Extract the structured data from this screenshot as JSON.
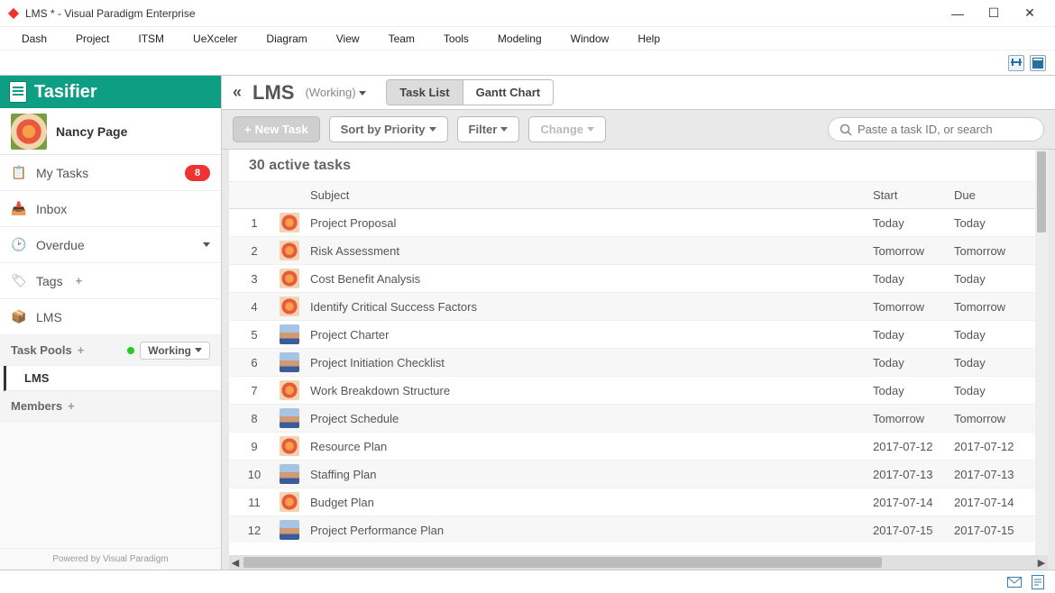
{
  "window": {
    "title": "LMS * - Visual Paradigm Enterprise"
  },
  "menu": [
    "Dash",
    "Project",
    "ITSM",
    "UeXceler",
    "Diagram",
    "View",
    "Team",
    "Tools",
    "Modeling",
    "Window",
    "Help"
  ],
  "sidebar": {
    "app_title": "Tasifier",
    "user_name": "Nancy Page",
    "items": {
      "mytasks": "My Tasks",
      "mytasks_badge": "8",
      "inbox": "Inbox",
      "overdue": "Overdue",
      "tags": "Tags",
      "lms": "LMS"
    },
    "pools_label": "Task Pools",
    "pools_filter": "Working",
    "pool_item": "LMS",
    "members_label": "Members",
    "footer": "Powered by Visual Paradigm"
  },
  "content": {
    "project": "LMS",
    "project_state": "(Working)",
    "tabs": {
      "tasklist": "Task List",
      "gantt": "Gantt Chart"
    },
    "toolbar": {
      "new_task": "New Task",
      "sort": "Sort by Priority",
      "filter": "Filter",
      "change": "Change"
    },
    "search_placeholder": "Paste a task ID, or search",
    "active_header": "30 active tasks",
    "columns": {
      "subject": "Subject",
      "start": "Start",
      "due": "Due"
    },
    "rows": [
      {
        "n": "1",
        "av": "flower",
        "subject": "Project Proposal",
        "start": "Today",
        "due": "Today"
      },
      {
        "n": "2",
        "av": "flower",
        "subject": "Risk Assessment",
        "start": "Tomorrow",
        "due": "Tomorrow"
      },
      {
        "n": "3",
        "av": "flower",
        "subject": "Cost Benefit Analysis",
        "start": "Today",
        "due": "Today"
      },
      {
        "n": "4",
        "av": "flower",
        "subject": "Identify Critical Success Factors",
        "start": "Tomorrow",
        "due": "Tomorrow"
      },
      {
        "n": "5",
        "av": "person",
        "subject": "Project Charter",
        "start": "Today",
        "due": "Today"
      },
      {
        "n": "6",
        "av": "person",
        "subject": "Project Initiation Checklist",
        "start": "Today",
        "due": "Today"
      },
      {
        "n": "7",
        "av": "flower",
        "subject": "Work Breakdown Structure",
        "start": "Today",
        "due": "Today"
      },
      {
        "n": "8",
        "av": "person",
        "subject": "Project Schedule",
        "start": "Tomorrow",
        "due": "Tomorrow"
      },
      {
        "n": "9",
        "av": "flower",
        "subject": "Resource Plan",
        "start": "2017-07-12",
        "due": "2017-07-12"
      },
      {
        "n": "10",
        "av": "person",
        "subject": "Staffing Plan",
        "start": "2017-07-13",
        "due": "2017-07-13"
      },
      {
        "n": "11",
        "av": "flower",
        "subject": "Budget Plan",
        "start": "2017-07-14",
        "due": "2017-07-14"
      },
      {
        "n": "12",
        "av": "person",
        "subject": "Project Performance Plan",
        "start": "2017-07-15",
        "due": "2017-07-15"
      }
    ]
  }
}
